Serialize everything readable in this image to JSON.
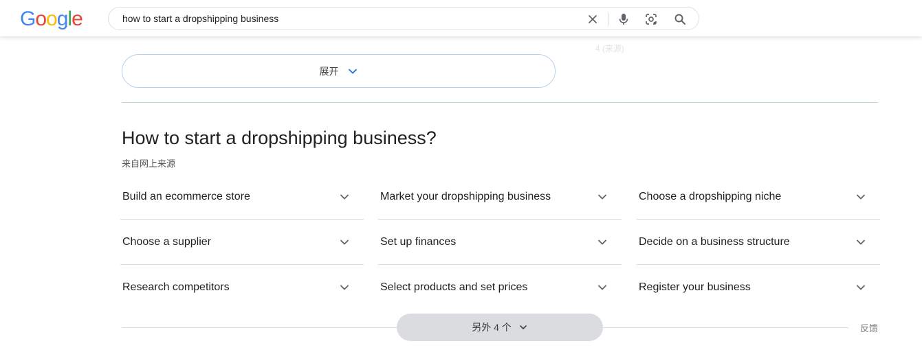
{
  "header": {
    "logo_letters": [
      "G",
      "o",
      "o",
      "g",
      "l",
      "e"
    ],
    "logo_colors": [
      "#4285F4",
      "#EA4335",
      "#FBBC05",
      "#4285F4",
      "#34A853",
      "#EA4335"
    ],
    "query": "how to start a dropshipping business",
    "icons": [
      "close-icon",
      "microphone-icon",
      "lens-icon",
      "search-icon"
    ]
  },
  "faded": {
    "right_text": "4 (来源)"
  },
  "expand": {
    "label": "展开"
  },
  "question": {
    "title": "How to start a dropshipping business?",
    "source": "来自网上来源"
  },
  "steps": [
    [
      "Build an ecommerce store",
      "Choose a supplier",
      "Research competitors"
    ],
    [
      "Market your dropshipping business",
      "Set up finances",
      "Select products and set prices"
    ],
    [
      "Choose a dropshipping niche",
      "Decide on a business structure",
      "Register your business"
    ]
  ],
  "more": {
    "label": "另外 4 个"
  },
  "feedback": {
    "label": "反馈"
  },
  "colors": {
    "accent_blue": "#1a73e8",
    "icon_gray": "#5f6368",
    "divider": "#dadce0"
  }
}
